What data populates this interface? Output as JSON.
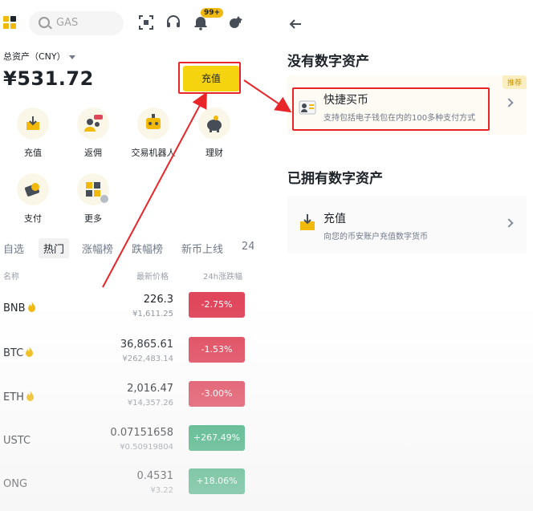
{
  "left": {
    "search": {
      "placeholder": "GAS"
    },
    "notification_badge": "99+",
    "total_assets_label": "总资产（CNY）",
    "total_assets_value": "¥531.72",
    "deposit_button": "充值",
    "shortcuts": [
      {
        "label": "充值",
        "icon": "deposit-icon"
      },
      {
        "label": "返佣",
        "icon": "referral-icon"
      },
      {
        "label": "交易机器人",
        "icon": "trading-bot-icon"
      },
      {
        "label": "理财",
        "icon": "earn-icon"
      },
      {
        "label": "支付",
        "icon": "pay-icon"
      },
      {
        "label": "更多",
        "icon": "more-icon"
      }
    ],
    "market_tabs": [
      "自选",
      "热门",
      "涨幅榜",
      "跌幅榜",
      "新币上线",
      "24"
    ],
    "active_tab": "热门",
    "columns": {
      "name": "名称",
      "price": "最新价格",
      "change": "24h涨跌幅"
    },
    "rows": [
      {
        "symbol": "BNB",
        "hot": true,
        "price": "226.3",
        "fiat": "¥1,611.25",
        "change": "-2.75%",
        "direction": "down"
      },
      {
        "symbol": "BTC",
        "hot": true,
        "price": "36,865.61",
        "fiat": "¥262,483.14",
        "change": "-1.53%",
        "direction": "down"
      },
      {
        "symbol": "ETH",
        "hot": true,
        "price": "2,016.47",
        "fiat": "¥14,357.26",
        "change": "-3.00%",
        "direction": "down"
      },
      {
        "symbol": "USTC",
        "hot": false,
        "price": "0.07151658",
        "fiat": "¥0.50919804",
        "change": "+267.49%",
        "direction": "up"
      },
      {
        "symbol": "ONG",
        "hot": false,
        "price": "0.4531",
        "fiat": "¥3.22",
        "change": "+18.06%",
        "direction": "up"
      }
    ]
  },
  "right": {
    "section_no_assets": "没有数字资产",
    "quick_buy": {
      "title": "快捷买币",
      "subtitle": "支持包括电子钱包在内的100多种支付方式",
      "tag": "推荐"
    },
    "section_has_assets": "已拥有数字资产",
    "deposit": {
      "title": "充值",
      "subtitle": "向您的币安账户充值数字货币"
    }
  },
  "colors": {
    "brand_yellow": "#f0b90b",
    "down_red": "#e0475c",
    "up_green": "#2aa870",
    "annotation_red": "#e8262a"
  }
}
